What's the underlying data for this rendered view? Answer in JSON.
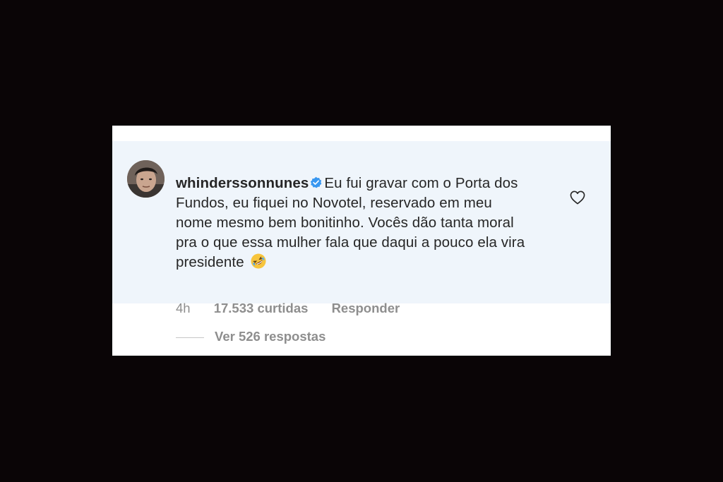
{
  "comment": {
    "username": "whinderssonnunes",
    "verified": true,
    "text": "Eu fui gravar com o Porta dos Fundos, eu fiquei no Novotel, reservado em meu nome mesmo bem bonitinho. Vocês dão tanta moral pra o que essa mulher fala que daqui a pouco ela vira presidente",
    "emoji": "rolling-on-floor-laughing-emoji",
    "time": "4h",
    "likes": "17.533 curtidas",
    "reply_label": "Responder",
    "like_icon": "heart-icon"
  },
  "replies": {
    "label": "Ver 526 respostas"
  },
  "colors": {
    "page_background": "#0a0506",
    "card_background": "#ffffff",
    "comment_highlight": "#eff5fb",
    "text_primary": "#262626",
    "text_secondary": "#8e8e8e",
    "verified_blue": "#3897f0"
  }
}
